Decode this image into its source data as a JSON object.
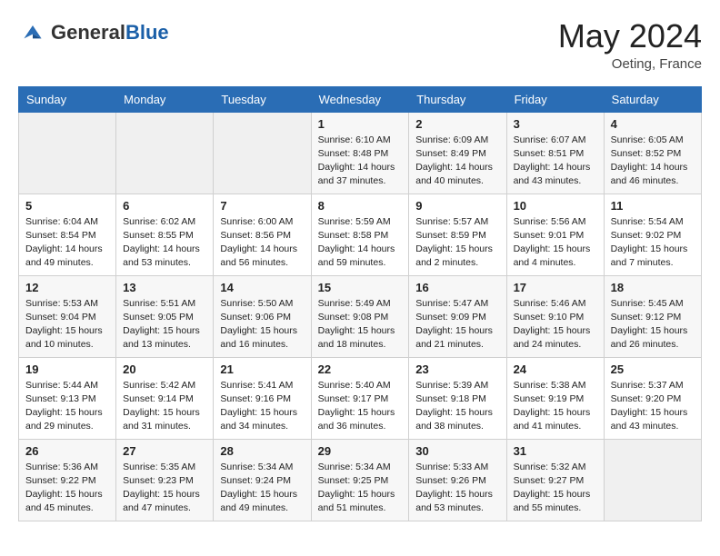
{
  "header": {
    "logo": {
      "general": "General",
      "blue": "Blue"
    },
    "title": "May 2024",
    "location": "Oeting, France"
  },
  "columns": [
    "Sunday",
    "Monday",
    "Tuesday",
    "Wednesday",
    "Thursday",
    "Friday",
    "Saturday"
  ],
  "weeks": [
    [
      {
        "day": "",
        "sunrise": "",
        "sunset": "",
        "daylight": ""
      },
      {
        "day": "",
        "sunrise": "",
        "sunset": "",
        "daylight": ""
      },
      {
        "day": "",
        "sunrise": "",
        "sunset": "",
        "daylight": ""
      },
      {
        "day": "1",
        "sunrise": "Sunrise: 6:10 AM",
        "sunset": "Sunset: 8:48 PM",
        "daylight": "Daylight: 14 hours and 37 minutes."
      },
      {
        "day": "2",
        "sunrise": "Sunrise: 6:09 AM",
        "sunset": "Sunset: 8:49 PM",
        "daylight": "Daylight: 14 hours and 40 minutes."
      },
      {
        "day": "3",
        "sunrise": "Sunrise: 6:07 AM",
        "sunset": "Sunset: 8:51 PM",
        "daylight": "Daylight: 14 hours and 43 minutes."
      },
      {
        "day": "4",
        "sunrise": "Sunrise: 6:05 AM",
        "sunset": "Sunset: 8:52 PM",
        "daylight": "Daylight: 14 hours and 46 minutes."
      }
    ],
    [
      {
        "day": "5",
        "sunrise": "Sunrise: 6:04 AM",
        "sunset": "Sunset: 8:54 PM",
        "daylight": "Daylight: 14 hours and 49 minutes."
      },
      {
        "day": "6",
        "sunrise": "Sunrise: 6:02 AM",
        "sunset": "Sunset: 8:55 PM",
        "daylight": "Daylight: 14 hours and 53 minutes."
      },
      {
        "day": "7",
        "sunrise": "Sunrise: 6:00 AM",
        "sunset": "Sunset: 8:56 PM",
        "daylight": "Daylight: 14 hours and 56 minutes."
      },
      {
        "day": "8",
        "sunrise": "Sunrise: 5:59 AM",
        "sunset": "Sunset: 8:58 PM",
        "daylight": "Daylight: 14 hours and 59 minutes."
      },
      {
        "day": "9",
        "sunrise": "Sunrise: 5:57 AM",
        "sunset": "Sunset: 8:59 PM",
        "daylight": "Daylight: 15 hours and 2 minutes."
      },
      {
        "day": "10",
        "sunrise": "Sunrise: 5:56 AM",
        "sunset": "Sunset: 9:01 PM",
        "daylight": "Daylight: 15 hours and 4 minutes."
      },
      {
        "day": "11",
        "sunrise": "Sunrise: 5:54 AM",
        "sunset": "Sunset: 9:02 PM",
        "daylight": "Daylight: 15 hours and 7 minutes."
      }
    ],
    [
      {
        "day": "12",
        "sunrise": "Sunrise: 5:53 AM",
        "sunset": "Sunset: 9:04 PM",
        "daylight": "Daylight: 15 hours and 10 minutes."
      },
      {
        "day": "13",
        "sunrise": "Sunrise: 5:51 AM",
        "sunset": "Sunset: 9:05 PM",
        "daylight": "Daylight: 15 hours and 13 minutes."
      },
      {
        "day": "14",
        "sunrise": "Sunrise: 5:50 AM",
        "sunset": "Sunset: 9:06 PM",
        "daylight": "Daylight: 15 hours and 16 minutes."
      },
      {
        "day": "15",
        "sunrise": "Sunrise: 5:49 AM",
        "sunset": "Sunset: 9:08 PM",
        "daylight": "Daylight: 15 hours and 18 minutes."
      },
      {
        "day": "16",
        "sunrise": "Sunrise: 5:47 AM",
        "sunset": "Sunset: 9:09 PM",
        "daylight": "Daylight: 15 hours and 21 minutes."
      },
      {
        "day": "17",
        "sunrise": "Sunrise: 5:46 AM",
        "sunset": "Sunset: 9:10 PM",
        "daylight": "Daylight: 15 hours and 24 minutes."
      },
      {
        "day": "18",
        "sunrise": "Sunrise: 5:45 AM",
        "sunset": "Sunset: 9:12 PM",
        "daylight": "Daylight: 15 hours and 26 minutes."
      }
    ],
    [
      {
        "day": "19",
        "sunrise": "Sunrise: 5:44 AM",
        "sunset": "Sunset: 9:13 PM",
        "daylight": "Daylight: 15 hours and 29 minutes."
      },
      {
        "day": "20",
        "sunrise": "Sunrise: 5:42 AM",
        "sunset": "Sunset: 9:14 PM",
        "daylight": "Daylight: 15 hours and 31 minutes."
      },
      {
        "day": "21",
        "sunrise": "Sunrise: 5:41 AM",
        "sunset": "Sunset: 9:16 PM",
        "daylight": "Daylight: 15 hours and 34 minutes."
      },
      {
        "day": "22",
        "sunrise": "Sunrise: 5:40 AM",
        "sunset": "Sunset: 9:17 PM",
        "daylight": "Daylight: 15 hours and 36 minutes."
      },
      {
        "day": "23",
        "sunrise": "Sunrise: 5:39 AM",
        "sunset": "Sunset: 9:18 PM",
        "daylight": "Daylight: 15 hours and 38 minutes."
      },
      {
        "day": "24",
        "sunrise": "Sunrise: 5:38 AM",
        "sunset": "Sunset: 9:19 PM",
        "daylight": "Daylight: 15 hours and 41 minutes."
      },
      {
        "day": "25",
        "sunrise": "Sunrise: 5:37 AM",
        "sunset": "Sunset: 9:20 PM",
        "daylight": "Daylight: 15 hours and 43 minutes."
      }
    ],
    [
      {
        "day": "26",
        "sunrise": "Sunrise: 5:36 AM",
        "sunset": "Sunset: 9:22 PM",
        "daylight": "Daylight: 15 hours and 45 minutes."
      },
      {
        "day": "27",
        "sunrise": "Sunrise: 5:35 AM",
        "sunset": "Sunset: 9:23 PM",
        "daylight": "Daylight: 15 hours and 47 minutes."
      },
      {
        "day": "28",
        "sunrise": "Sunrise: 5:34 AM",
        "sunset": "Sunset: 9:24 PM",
        "daylight": "Daylight: 15 hours and 49 minutes."
      },
      {
        "day": "29",
        "sunrise": "Sunrise: 5:34 AM",
        "sunset": "Sunset: 9:25 PM",
        "daylight": "Daylight: 15 hours and 51 minutes."
      },
      {
        "day": "30",
        "sunrise": "Sunrise: 5:33 AM",
        "sunset": "Sunset: 9:26 PM",
        "daylight": "Daylight: 15 hours and 53 minutes."
      },
      {
        "day": "31",
        "sunrise": "Sunrise: 5:32 AM",
        "sunset": "Sunset: 9:27 PM",
        "daylight": "Daylight: 15 hours and 55 minutes."
      },
      {
        "day": "",
        "sunrise": "",
        "sunset": "",
        "daylight": ""
      }
    ]
  ]
}
